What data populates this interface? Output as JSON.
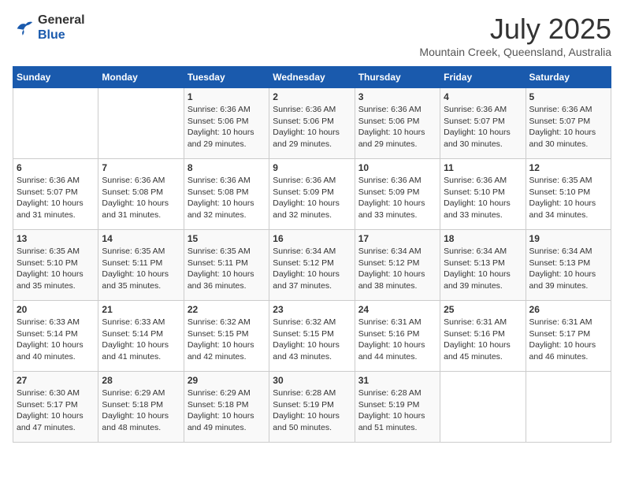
{
  "logo": {
    "line1": "General",
    "line2": "Blue"
  },
  "title": {
    "month_year": "July 2025",
    "location": "Mountain Creek, Queensland, Australia"
  },
  "weekdays": [
    "Sunday",
    "Monday",
    "Tuesday",
    "Wednesday",
    "Thursday",
    "Friday",
    "Saturday"
  ],
  "weeks": [
    [
      {
        "day": "",
        "info": ""
      },
      {
        "day": "",
        "info": ""
      },
      {
        "day": "1",
        "info": "Sunrise: 6:36 AM\nSunset: 5:06 PM\nDaylight: 10 hours\nand 29 minutes."
      },
      {
        "day": "2",
        "info": "Sunrise: 6:36 AM\nSunset: 5:06 PM\nDaylight: 10 hours\nand 29 minutes."
      },
      {
        "day": "3",
        "info": "Sunrise: 6:36 AM\nSunset: 5:06 PM\nDaylight: 10 hours\nand 29 minutes."
      },
      {
        "day": "4",
        "info": "Sunrise: 6:36 AM\nSunset: 5:07 PM\nDaylight: 10 hours\nand 30 minutes."
      },
      {
        "day": "5",
        "info": "Sunrise: 6:36 AM\nSunset: 5:07 PM\nDaylight: 10 hours\nand 30 minutes."
      }
    ],
    [
      {
        "day": "6",
        "info": "Sunrise: 6:36 AM\nSunset: 5:07 PM\nDaylight: 10 hours\nand 31 minutes."
      },
      {
        "day": "7",
        "info": "Sunrise: 6:36 AM\nSunset: 5:08 PM\nDaylight: 10 hours\nand 31 minutes."
      },
      {
        "day": "8",
        "info": "Sunrise: 6:36 AM\nSunset: 5:08 PM\nDaylight: 10 hours\nand 32 minutes."
      },
      {
        "day": "9",
        "info": "Sunrise: 6:36 AM\nSunset: 5:09 PM\nDaylight: 10 hours\nand 32 minutes."
      },
      {
        "day": "10",
        "info": "Sunrise: 6:36 AM\nSunset: 5:09 PM\nDaylight: 10 hours\nand 33 minutes."
      },
      {
        "day": "11",
        "info": "Sunrise: 6:36 AM\nSunset: 5:10 PM\nDaylight: 10 hours\nand 33 minutes."
      },
      {
        "day": "12",
        "info": "Sunrise: 6:35 AM\nSunset: 5:10 PM\nDaylight: 10 hours\nand 34 minutes."
      }
    ],
    [
      {
        "day": "13",
        "info": "Sunrise: 6:35 AM\nSunset: 5:10 PM\nDaylight: 10 hours\nand 35 minutes."
      },
      {
        "day": "14",
        "info": "Sunrise: 6:35 AM\nSunset: 5:11 PM\nDaylight: 10 hours\nand 35 minutes."
      },
      {
        "day": "15",
        "info": "Sunrise: 6:35 AM\nSunset: 5:11 PM\nDaylight: 10 hours\nand 36 minutes."
      },
      {
        "day": "16",
        "info": "Sunrise: 6:34 AM\nSunset: 5:12 PM\nDaylight: 10 hours\nand 37 minutes."
      },
      {
        "day": "17",
        "info": "Sunrise: 6:34 AM\nSunset: 5:12 PM\nDaylight: 10 hours\nand 38 minutes."
      },
      {
        "day": "18",
        "info": "Sunrise: 6:34 AM\nSunset: 5:13 PM\nDaylight: 10 hours\nand 39 minutes."
      },
      {
        "day": "19",
        "info": "Sunrise: 6:34 AM\nSunset: 5:13 PM\nDaylight: 10 hours\nand 39 minutes."
      }
    ],
    [
      {
        "day": "20",
        "info": "Sunrise: 6:33 AM\nSunset: 5:14 PM\nDaylight: 10 hours\nand 40 minutes."
      },
      {
        "day": "21",
        "info": "Sunrise: 6:33 AM\nSunset: 5:14 PM\nDaylight: 10 hours\nand 41 minutes."
      },
      {
        "day": "22",
        "info": "Sunrise: 6:32 AM\nSunset: 5:15 PM\nDaylight: 10 hours\nand 42 minutes."
      },
      {
        "day": "23",
        "info": "Sunrise: 6:32 AM\nSunset: 5:15 PM\nDaylight: 10 hours\nand 43 minutes."
      },
      {
        "day": "24",
        "info": "Sunrise: 6:31 AM\nSunset: 5:16 PM\nDaylight: 10 hours\nand 44 minutes."
      },
      {
        "day": "25",
        "info": "Sunrise: 6:31 AM\nSunset: 5:16 PM\nDaylight: 10 hours\nand 45 minutes."
      },
      {
        "day": "26",
        "info": "Sunrise: 6:31 AM\nSunset: 5:17 PM\nDaylight: 10 hours\nand 46 minutes."
      }
    ],
    [
      {
        "day": "27",
        "info": "Sunrise: 6:30 AM\nSunset: 5:17 PM\nDaylight: 10 hours\nand 47 minutes."
      },
      {
        "day": "28",
        "info": "Sunrise: 6:29 AM\nSunset: 5:18 PM\nDaylight: 10 hours\nand 48 minutes."
      },
      {
        "day": "29",
        "info": "Sunrise: 6:29 AM\nSunset: 5:18 PM\nDaylight: 10 hours\nand 49 minutes."
      },
      {
        "day": "30",
        "info": "Sunrise: 6:28 AM\nSunset: 5:19 PM\nDaylight: 10 hours\nand 50 minutes."
      },
      {
        "day": "31",
        "info": "Sunrise: 6:28 AM\nSunset: 5:19 PM\nDaylight: 10 hours\nand 51 minutes."
      },
      {
        "day": "",
        "info": ""
      },
      {
        "day": "",
        "info": ""
      }
    ]
  ]
}
